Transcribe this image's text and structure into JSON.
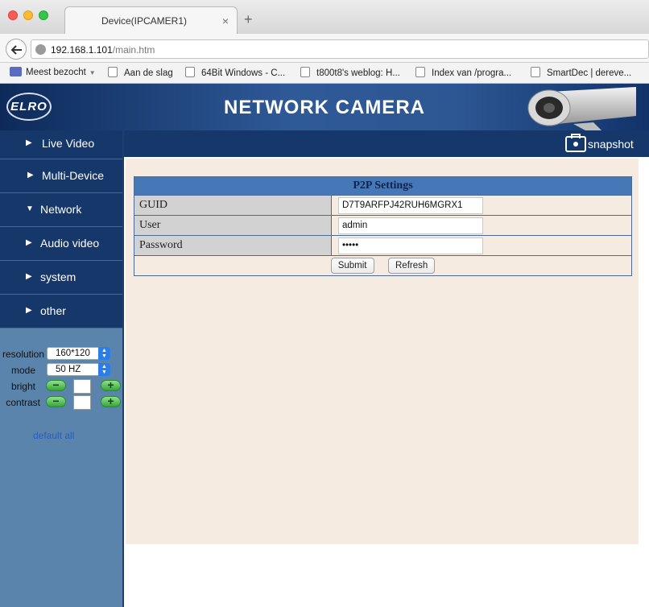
{
  "browser": {
    "tab_title": "Device(IPCAMER1)",
    "tab_close": "×",
    "new_tab": "+",
    "url_host": "192.168.1.101",
    "url_path": "/main.htm",
    "bookmarks": [
      {
        "label": "Meest bezocht",
        "icon": "bookmarks-folder-icon"
      },
      {
        "label": "Aan de slag",
        "icon": "page-icon"
      },
      {
        "label": "64Bit Windows - C...",
        "icon": "page-icon"
      },
      {
        "label": "t800t8's weblog: H...",
        "icon": "page-icon"
      },
      {
        "label": "Index van /progra...",
        "icon": "page-icon"
      },
      {
        "label": "SmartDec | dereve...",
        "icon": "page-icon"
      }
    ]
  },
  "header": {
    "logo": "ELRO",
    "title": "NETWORK CAMERA"
  },
  "menu": [
    {
      "label": "Live Video",
      "arrow": "▶"
    },
    {
      "label": "Multi-Device",
      "arrow": "▶"
    },
    {
      "label": "Network",
      "arrow": "▼"
    },
    {
      "label": "Audio video",
      "arrow": "▶"
    },
    {
      "label": "system",
      "arrow": "▶"
    },
    {
      "label": "other",
      "arrow": "▶"
    }
  ],
  "controls": {
    "resolution_label": "resolution",
    "resolution_value": "160*120",
    "mode_label": "mode",
    "mode_value": "50 HZ",
    "bright_label": "bright",
    "contrast_label": "contrast",
    "minus": "−",
    "plus": "+",
    "default_all": "default all"
  },
  "toolbar": {
    "snapshot_label": "snapshot"
  },
  "p2p": {
    "title": "P2P Settings",
    "guid_label": "GUID",
    "guid_value": "D7T9ARFPJ42RUH6MGRX1",
    "user_label": "User",
    "user_value": "admin",
    "password_label": "Password",
    "password_value": "•••••",
    "submit_label": "Submit",
    "refresh_label": "Refresh"
  },
  "colors": {
    "menu_bg": "#16376a",
    "sidebar_bg": "#5a84ab",
    "content_bg": "#f5ebe1",
    "table_header": "#4677b6"
  }
}
